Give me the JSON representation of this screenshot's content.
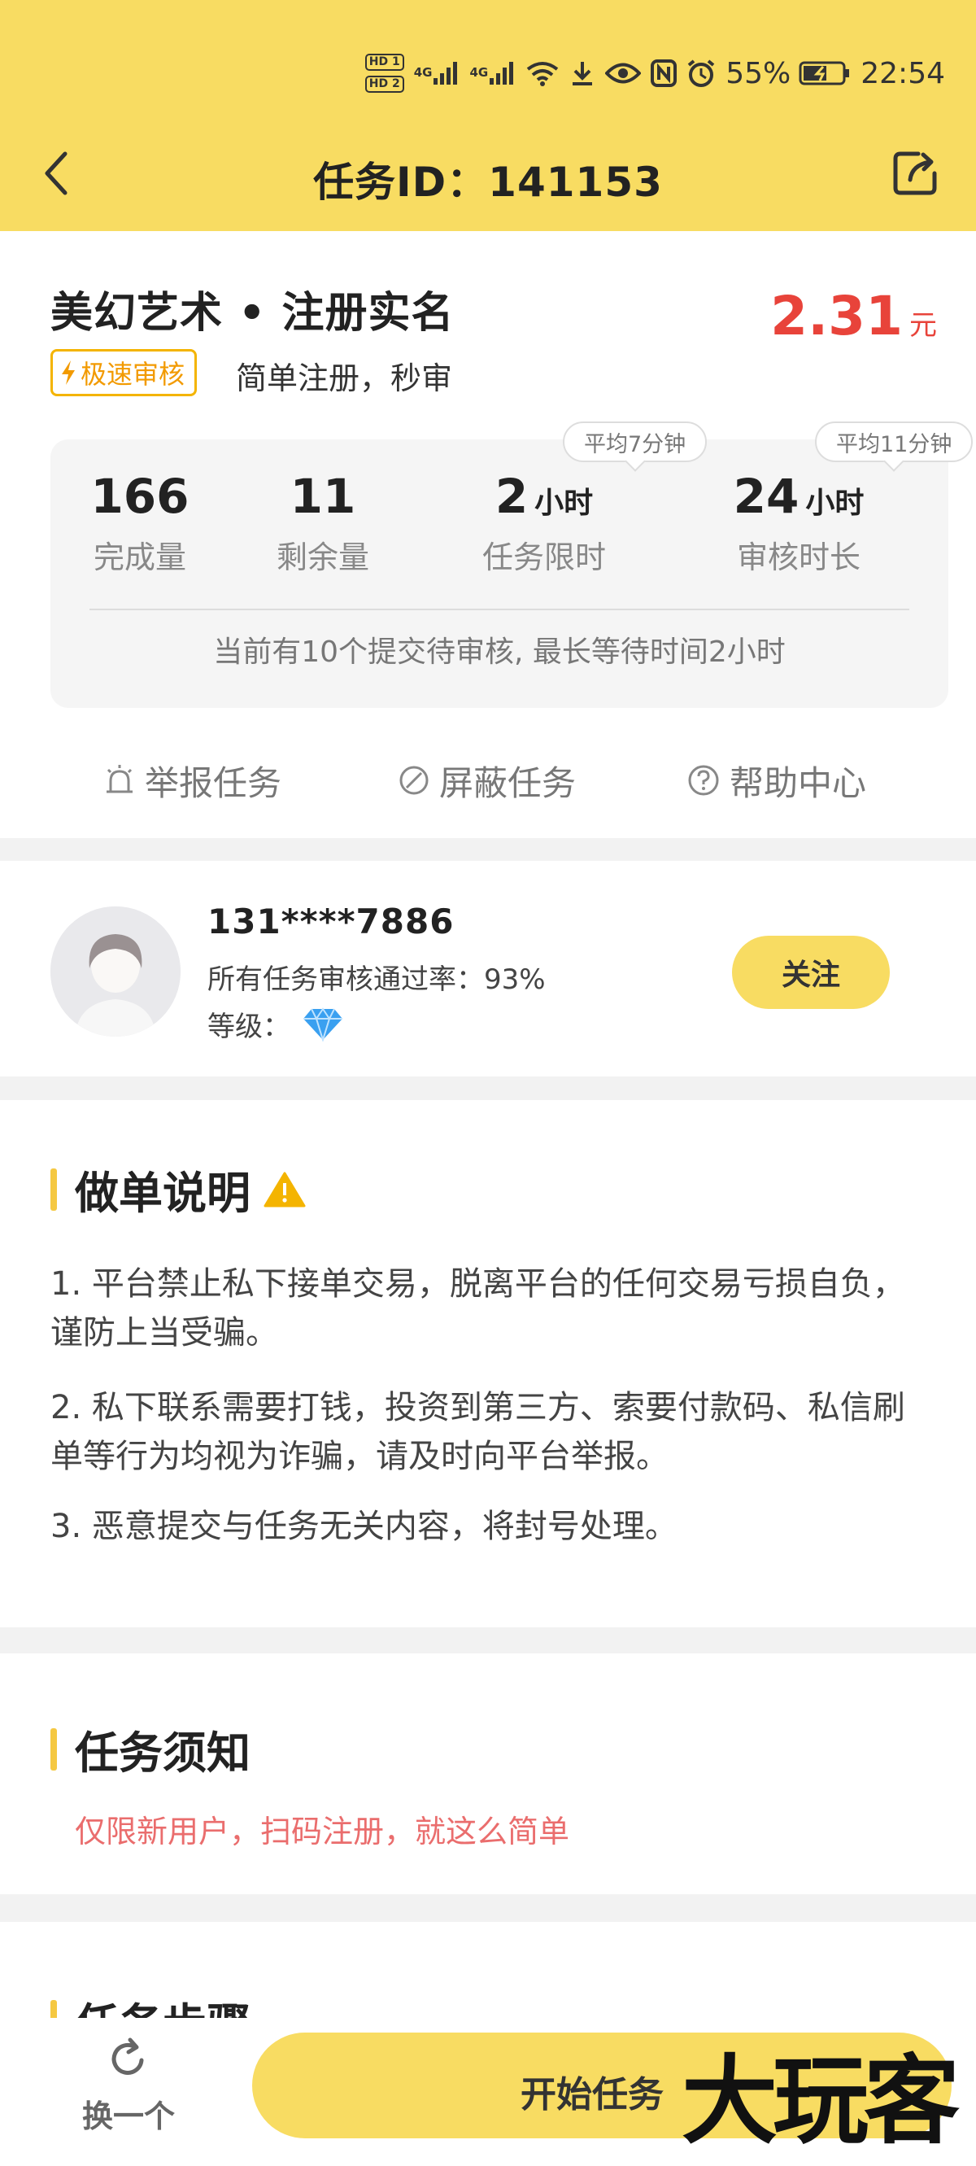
{
  "status_bar": {
    "hd1": "HD 1",
    "hd2": "HD 2",
    "net1": "4G",
    "net2": "4G",
    "battery": "55%",
    "time": "22:54"
  },
  "header": {
    "title": "任务ID：141153",
    "back_icon": "chevron-left-icon",
    "share_icon": "share-icon",
    "background": "#f8dc62"
  },
  "task": {
    "title": "美幻艺术 • 注册实名",
    "price": "2.31",
    "price_unit": "元",
    "badge": "极速审核",
    "subtitle": "简单注册，秒审",
    "stats": [
      {
        "value": "166",
        "unit": "",
        "label": "完成量",
        "tooltip": ""
      },
      {
        "value": "11",
        "unit": "",
        "label": "剩余量",
        "tooltip": ""
      },
      {
        "value": "2",
        "unit": "小时",
        "label": "任务限时",
        "tooltip": "平均7分钟"
      },
      {
        "value": "24",
        "unit": "小时",
        "label": "审核时长",
        "tooltip": "平均11分钟"
      }
    ],
    "queue_note": "当前有10个提交待审核, 最长等待时间2小时",
    "actions": [
      {
        "label": "举报任务",
        "icon": "alarm-bell-icon"
      },
      {
        "label": "屏蔽任务",
        "icon": "block-icon"
      },
      {
        "label": "帮助中心",
        "icon": "help-icon"
      }
    ]
  },
  "publisher": {
    "phone": "131****7886",
    "pass_rate": "所有任务审核通过率：93%",
    "level_label": "等级：",
    "level_icon": "diamond-icon",
    "follow": "关注"
  },
  "instructions": {
    "title": "做单说明",
    "warning_icon": "warning-icon",
    "rules": [
      "1. 平台禁止私下接单交易，脱离平台的任何交易亏损自负，谨防上当受骗。",
      "2. 私下联系需要打钱，投资到第三方、索要付款码、私信刷单等行为均视为诈骗，请及时向平台举报。",
      "3. 恶意提交与任务无关内容，将封号处理。"
    ]
  },
  "notice": {
    "title": "任务须知",
    "text": "仅限新用户，扫码注册，就这么简单",
    "text_color": "#ea6d6d"
  },
  "steps": {
    "title": "任务步骤"
  },
  "bottom": {
    "switch_label": "换一个",
    "switch_icon": "refresh-icon",
    "start_label": "开始任务",
    "watermark": "大玩客"
  },
  "colors": {
    "accent": "#f8dc62",
    "price": "#e8433a",
    "badge": "#f4b400"
  }
}
